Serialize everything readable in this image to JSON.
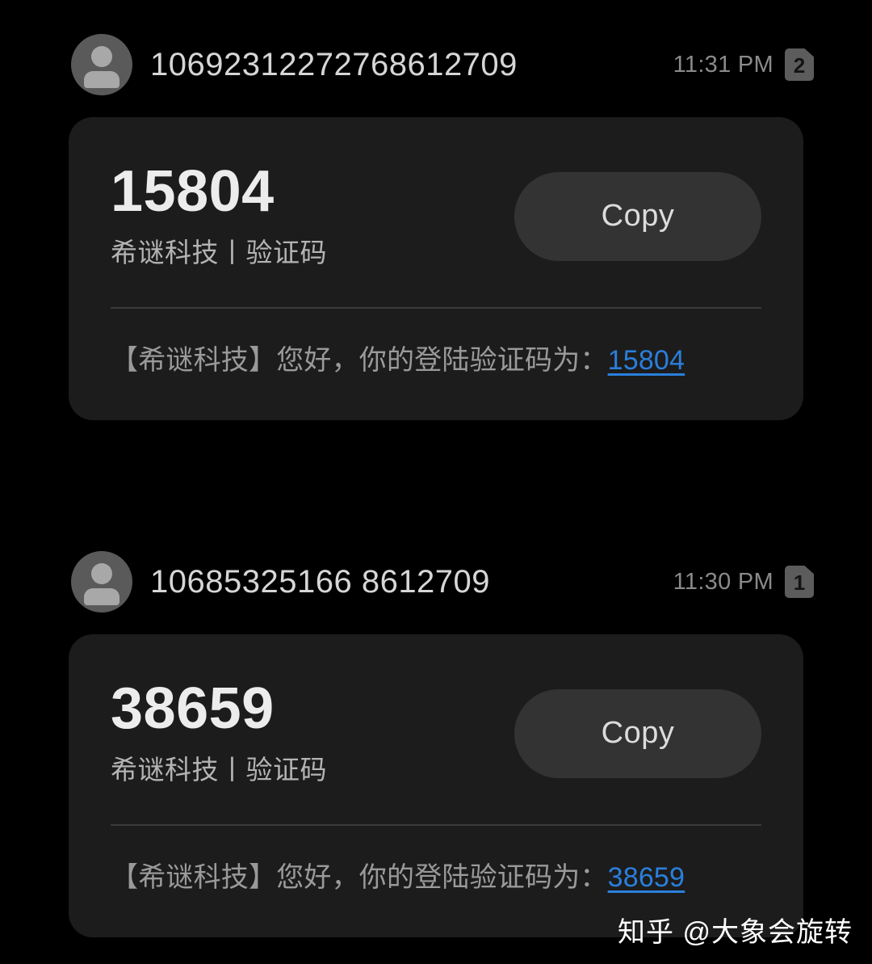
{
  "app": {
    "background_color": "#000000",
    "card_color": "#1c1c1c",
    "accent_link_color": "#2a7fdb"
  },
  "messages": [
    {
      "sender": "10692312272768612709",
      "timestamp": "11:31 PM",
      "sim_badge": "2",
      "avatar_icon": "person-icon",
      "card": {
        "code": "15804",
        "label": "希谜科技丨验证码",
        "copy_label": "Copy",
        "body_prefix": "【希谜科技】您好，你的登陆验证码为：",
        "body_link": "15804"
      }
    },
    {
      "sender": "10685325166 8612709",
      "timestamp": "11:30 PM",
      "sim_badge": "1",
      "avatar_icon": "person-icon",
      "card": {
        "code": "38659",
        "label": "希谜科技丨验证码",
        "copy_label": "Copy",
        "body_prefix": "【希谜科技】您好，你的登陆验证码为：",
        "body_link": "38659"
      }
    }
  ],
  "watermark": "知乎 @大象会旋转"
}
